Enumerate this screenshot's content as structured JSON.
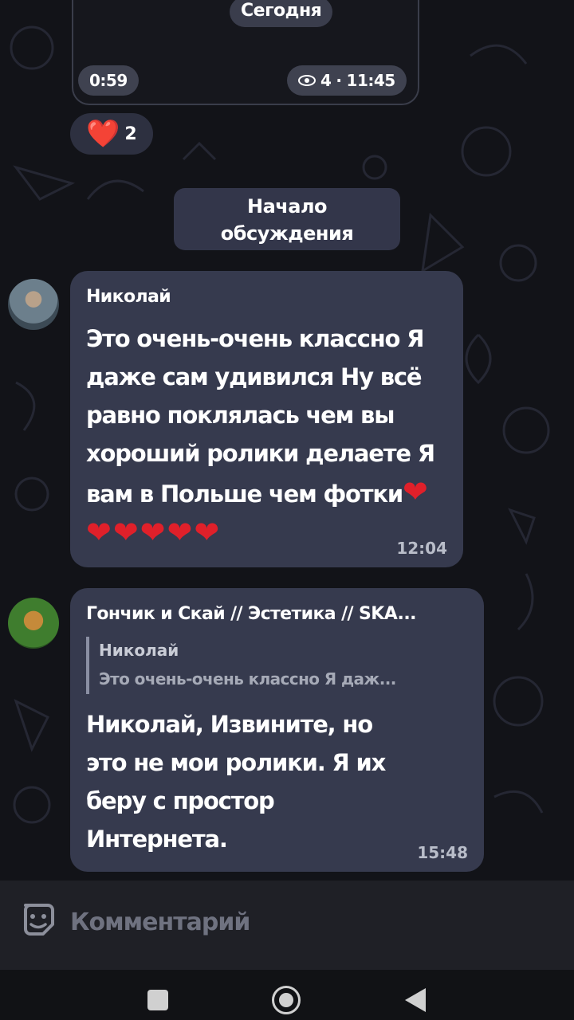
{
  "video_message": {
    "date_label": "Сегодня",
    "duration": "0:59",
    "views": "4",
    "time": "11:45"
  },
  "reaction": {
    "emoji": "❤️",
    "count": "2"
  },
  "service_message": {
    "line1": "Начало",
    "line2": "обсуждения"
  },
  "messages": [
    {
      "author": "Николай",
      "text": "Это очень-очень классно Я даже сам удивился Ну всё равно поклялась чем вы хороший ролики делаете Я вам в Польше чем фотки",
      "hearts": "❤❤❤❤❤❤",
      "time": "12:04"
    },
    {
      "author": "Гончик и Скай // Эстетика // SKA...",
      "reply_author": "Николай",
      "reply_text": "Это очень-очень классно Я даж...",
      "text": "Николай, Извините, но это не мои ролики. Я их беру с простор Интернета.",
      "time": "15:48"
    }
  ],
  "input": {
    "placeholder": "Комментарий"
  }
}
